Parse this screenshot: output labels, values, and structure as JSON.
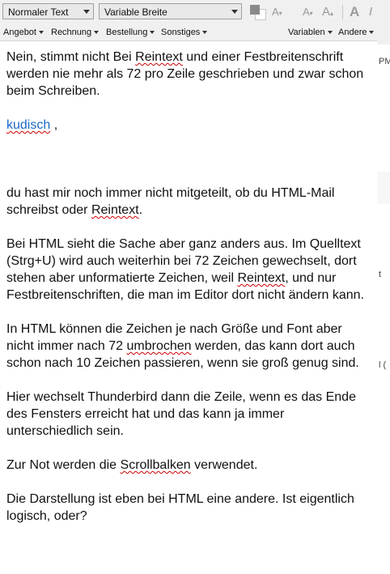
{
  "toolbar": {
    "paragraph_format": "Normaler Text",
    "font": "Variable Breite",
    "size_icons": [
      "A",
      "A",
      "A",
      "A"
    ]
  },
  "menus": {
    "angebot": "Angebot",
    "rechnung": "Rechnung",
    "bestellung": "Bestellung",
    "sonstiges": "Sonstiges",
    "variablen": "Variablen",
    "andere": "Andere"
  },
  "message": {
    "p1": "Nein, stimmt nicht Bei Reintext und einer Festbreitenschrift werden nie mehr als 72 pro Zeile geschrieben und zwar schon beim Schreiben.",
    "p2_link": "kudisch",
    "p2_rest": " ,",
    "p3": "du hast mir noch immer nicht mitgeteilt, ob du HTML-Mail schreibst oder Reintext.",
    "p4": "Bei HTML sieht die Sache aber ganz anders aus. Im Quelltext (Strg+U) wird auch weiterhin bei 72 Zeichen gewechselt, dort stehen aber unformatierte Zeichen, weil Reintext, und nur Festbreitenschriften, die man im Editor dort nicht ändern kann.",
    "p5": "In HTML können die Zeichen je nach Größe und Font aber nicht immer nach 72 umbrochen werden, das kann dort auch schon nach 10 Zeichen passieren, wenn sie groß genug sind.",
    "p6": "Hier wechselt Thunderbird dann die Zeile, wenn es das Ende des Fensters erreicht hat und das kann ja immer unterschiedlich sein.",
    "p7": "Zur Not werden die Scrollbalken verwendet.",
    "p8": "Die Darstellung ist eben bei HTML eine andere. Ist eigentlich logisch, oder?"
  },
  "background_fragments": [
    "PM",
    "t",
    "l ("
  ]
}
